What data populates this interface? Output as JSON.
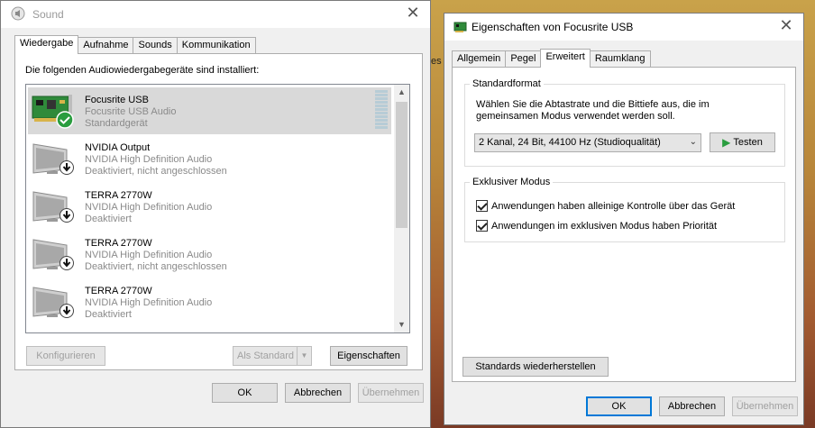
{
  "desktop": {
    "label": "es"
  },
  "sound_window": {
    "title": "Sound",
    "tabs": [
      {
        "label": "Wiedergabe",
        "active": true
      },
      {
        "label": "Aufnahme",
        "active": false
      },
      {
        "label": "Sounds",
        "active": false
      },
      {
        "label": "Kommunikation",
        "active": false
      }
    ],
    "intro": "Die folgenden Audiowiedergabegeräte sind installiert:",
    "devices": [
      {
        "name": "Focusrite USB",
        "description": "Focusrite USB Audio",
        "status": "Standardgerät",
        "selected": true,
        "icon": "sound-card-icon",
        "badge": "default-check-icon"
      },
      {
        "name": "NVIDIA Output",
        "description": "NVIDIA High Definition Audio",
        "status": "Deaktiviert, nicht angeschlossen",
        "selected": false,
        "icon": "monitor-icon",
        "badge": "disabled-arrow-icon"
      },
      {
        "name": "TERRA 2770W",
        "description": "NVIDIA High Definition Audio",
        "status": "Deaktiviert",
        "selected": false,
        "icon": "monitor-icon",
        "badge": "disabled-arrow-icon"
      },
      {
        "name": "TERRA 2770W",
        "description": "NVIDIA High Definition Audio",
        "status": "Deaktiviert, nicht angeschlossen",
        "selected": false,
        "icon": "monitor-icon",
        "badge": "disabled-arrow-icon"
      },
      {
        "name": "TERRA 2770W",
        "description": "NVIDIA High Definition Audio",
        "status": "Deaktiviert",
        "selected": false,
        "icon": "monitor-icon",
        "badge": "disabled-arrow-icon"
      }
    ],
    "buttons": {
      "configure": "Konfigurieren",
      "set_default": "Als Standard",
      "properties": "Eigenschaften",
      "ok": "OK",
      "cancel": "Abbrechen",
      "apply": "Übernehmen"
    }
  },
  "props_window": {
    "title": "Eigenschaften von Focusrite USB",
    "tabs": [
      {
        "label": "Allgemein",
        "active": false
      },
      {
        "label": "Pegel",
        "active": false
      },
      {
        "label": "Erweitert",
        "active": true
      },
      {
        "label": "Raumklang",
        "active": false
      }
    ],
    "default_format": {
      "legend": "Standardformat",
      "description": "Wählen Sie die Abtastrate und die Bittiefe aus, die im gemeinsamen Modus verwendet werden soll.",
      "selected_format": "2 Kanal, 24 Bit, 44100 Hz (Studioqualität)",
      "test_button": "Testen"
    },
    "exclusive_mode": {
      "legend": "Exklusiver Modus",
      "options": [
        {
          "label": "Anwendungen haben alleinige Kontrolle über das Gerät",
          "checked": true
        },
        {
          "label": "Anwendungen im exklusiven Modus haben Priorität",
          "checked": true
        }
      ]
    },
    "buttons": {
      "restore": "Standards wiederherstellen",
      "ok": "OK",
      "cancel": "Abbrechen",
      "apply": "Übernehmen"
    }
  }
}
